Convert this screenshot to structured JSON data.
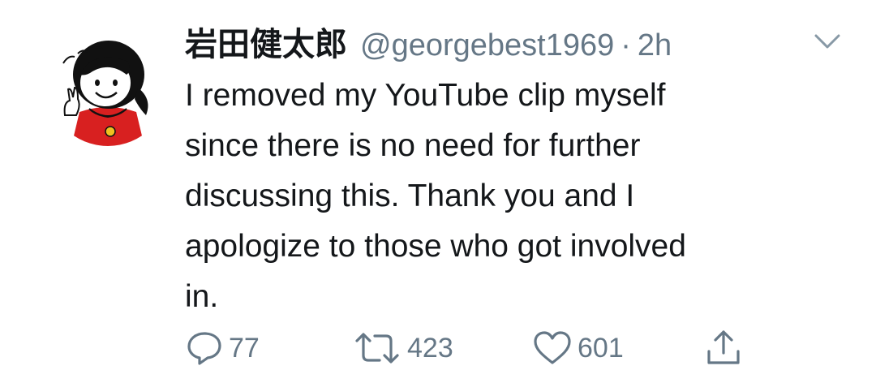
{
  "tweet": {
    "display_name": "岩田健太郎",
    "handle": "@georgebest1969",
    "separator": "·",
    "time": "2h",
    "avatar_icon": "cartoon-girl-avatar",
    "more_icon": "chevron-down-icon",
    "text": "I removed my YouTube clip myself\nsince there is no need for further\ndiscussing this. Thank you and I\napologize to those who got involved\nin.",
    "actions": {
      "reply": {
        "icon": "reply-icon",
        "count": "77"
      },
      "retweet": {
        "icon": "retweet-icon",
        "count": "423"
      },
      "like": {
        "icon": "heart-icon",
        "count": "601"
      },
      "share": {
        "icon": "share-icon"
      }
    },
    "colors": {
      "text": "#14171a",
      "muted": "#657786",
      "avatar_dress": "#d82020"
    }
  }
}
